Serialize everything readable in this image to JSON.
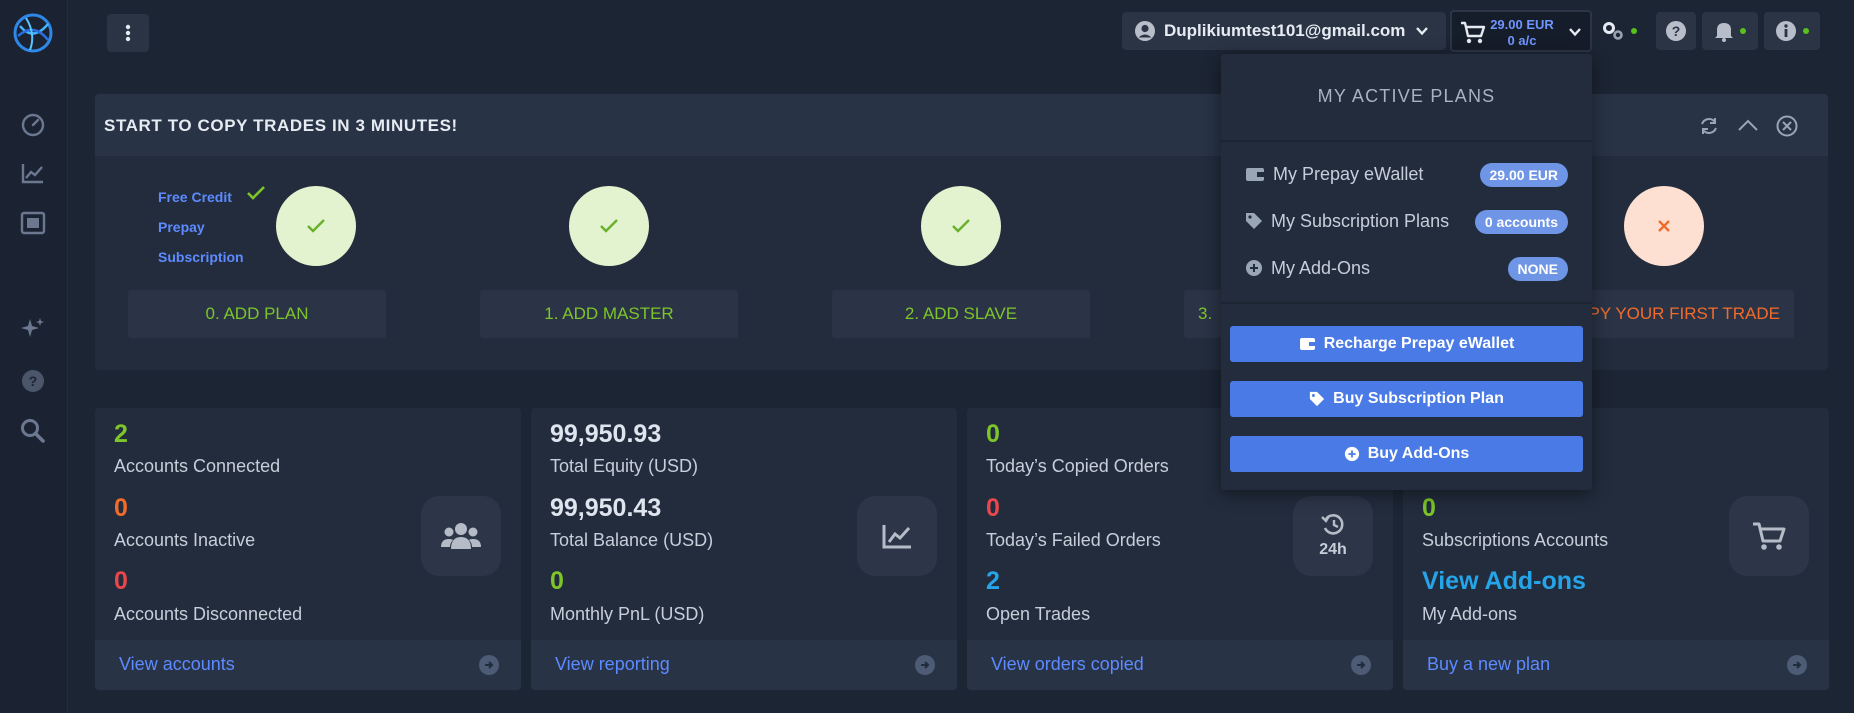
{
  "topbar": {
    "user_email": "Duplikiumtest101@gmail.com",
    "cart_amount": "29.00 EUR",
    "cart_accounts": "0 a/c"
  },
  "banner": {
    "title": "START TO COPY TRADES IN 3 MINUTES!",
    "plan_items": [
      "Free Credit",
      "Prepay",
      "Subscription"
    ],
    "steps": [
      {
        "label": "0. ADD PLAN",
        "status": "done"
      },
      {
        "label": "1. ADD MASTER",
        "status": "done"
      },
      {
        "label": "2. ADD SLAVE",
        "status": "done"
      },
      {
        "label": "3.",
        "status": "done"
      },
      {
        "label": "PY YOUR FIRST TRADE",
        "status": "pending"
      }
    ]
  },
  "cards": {
    "accounts": {
      "connected_value": "2",
      "connected_label": "Accounts Connected",
      "inactive_value": "0",
      "inactive_label": "Accounts Inactive",
      "disconnected_value": "0",
      "disconnected_label": "Accounts Disconnected",
      "link": "View accounts"
    },
    "equity": {
      "equity_value": "99,950.93",
      "equity_label": "Total Equity (USD)",
      "balance_value": "99,950.43",
      "balance_label": "Total Balance (USD)",
      "pnl_value": "0",
      "pnl_label": "Monthly PnL (USD)",
      "link": "View reporting"
    },
    "orders": {
      "copied_value": "0",
      "copied_label": "Today’s Copied Orders",
      "failed_value": "0",
      "failed_label": "Today’s Failed Orders",
      "open_value": "2",
      "open_label": "Open Trades",
      "icon_text": "24h",
      "link": "View orders copied"
    },
    "plans": {
      "subs_value": "0",
      "subs_label": "Subscriptions Accounts",
      "addons_link": "View Add-ons",
      "addons_label": "My Add-ons",
      "link": "Buy a new plan"
    }
  },
  "dropdown": {
    "title": "MY ACTIVE PLANS",
    "rows": [
      {
        "label": "My Prepay eWallet",
        "badge": "29.00 EUR",
        "icon": "wallet-icon"
      },
      {
        "label": "My Subscription Plans",
        "badge": "0 accounts",
        "icon": "tag-icon"
      },
      {
        "label": "My Add-Ons",
        "badge": "NONE",
        "icon": "plus-circle-icon"
      }
    ],
    "buttons": [
      "Recharge Prepay eWallet",
      "Buy Subscription Plan",
      "Buy Add-Ons"
    ]
  },
  "colors": {
    "accent_blue": "#5d8bff",
    "green": "#7dc529",
    "orange": "#f26b2a",
    "red": "#e8474c",
    "cyan": "#25a4e8"
  }
}
